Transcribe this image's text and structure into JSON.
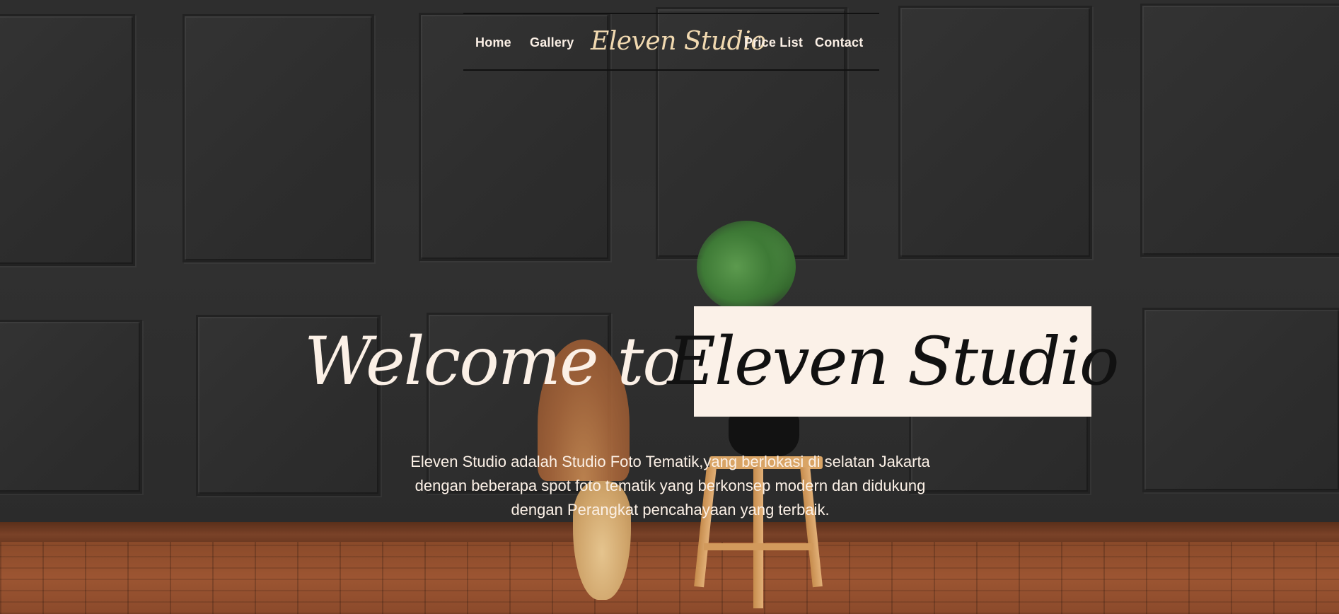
{
  "nav": {
    "links": [
      "Home",
      "Gallery",
      "Price List",
      "Contact"
    ],
    "brand": "Eleven Studio"
  },
  "hero": {
    "welcome": "Welcome to",
    "brand_highlight": "Eleven Studio",
    "description": "Eleven Studio adalah Studio Foto Tematik,yang berlokasi di selatan Jakarta dengan beberapa spot foto tematik yang berkonsep modern dan didukung dengan Perangkat pencahayaan yang terbaik."
  },
  "colors": {
    "nav_text": "#fbf0e6",
    "brand_script": "#f1d9b0",
    "highlight_bg": "#fbf1e8",
    "wall": "#2e2e2e",
    "floor": "#9c5532"
  }
}
